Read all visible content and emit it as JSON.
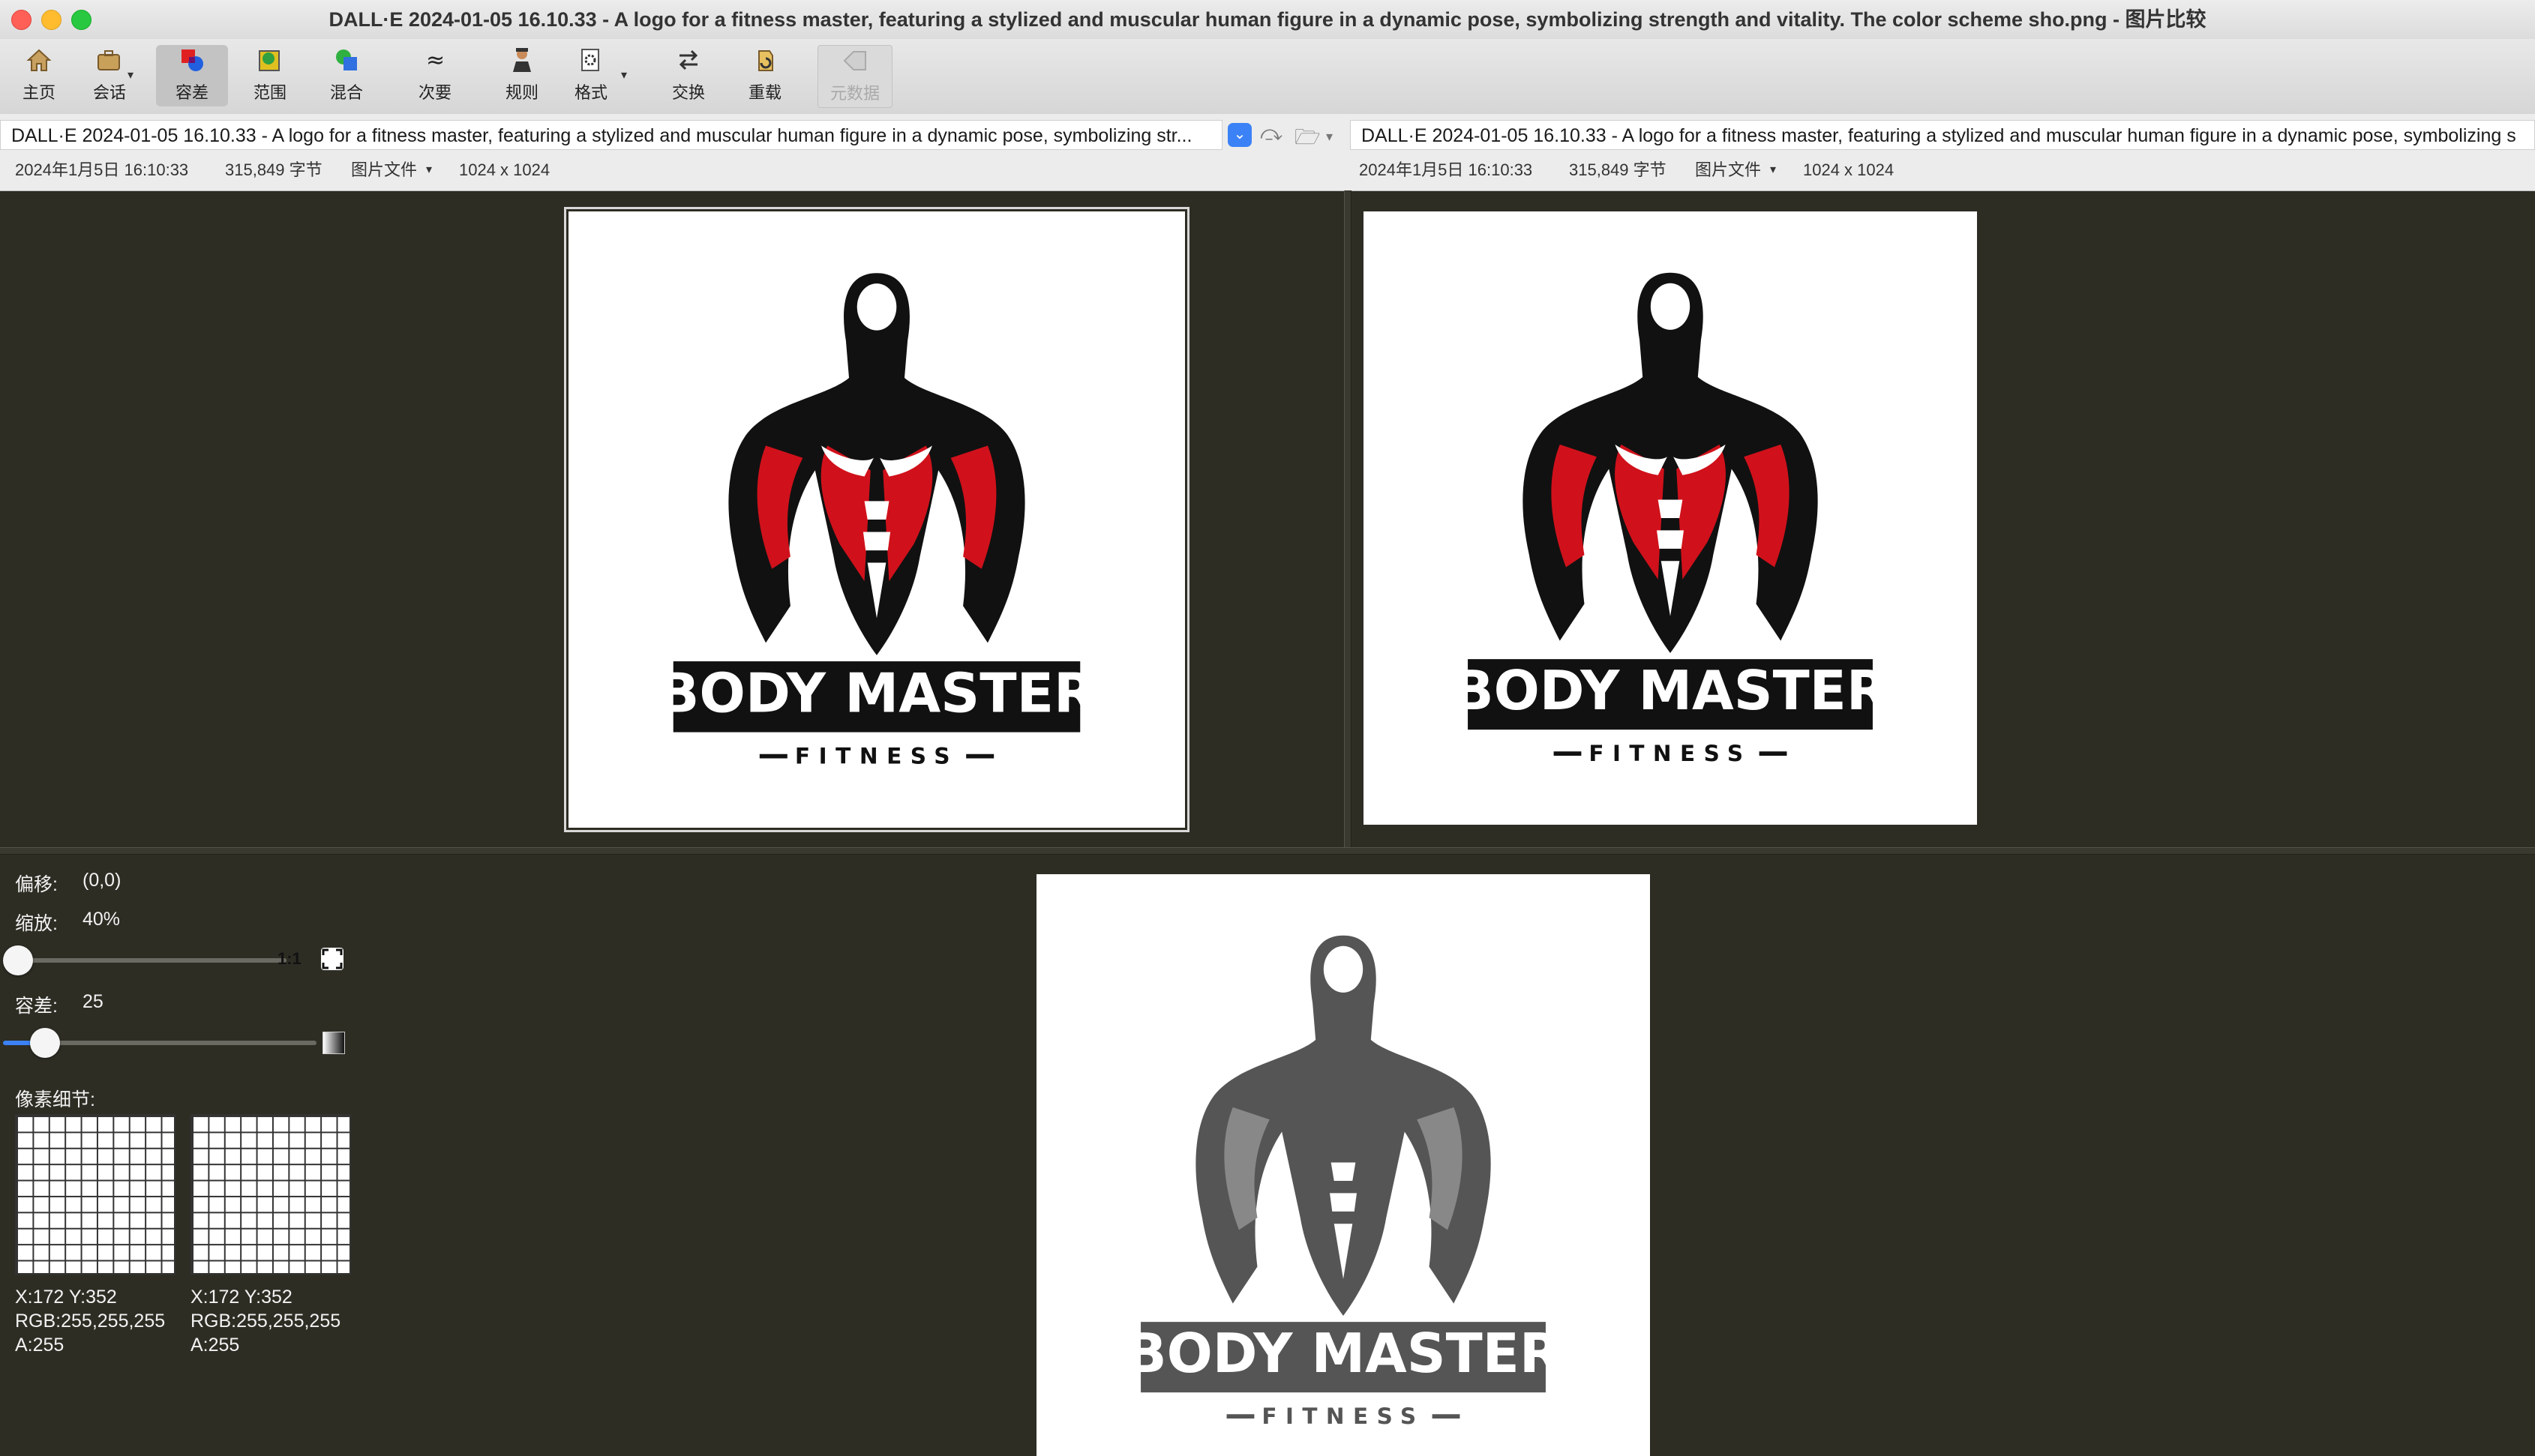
{
  "window": {
    "title": "DALL·E 2024-01-05 16.10.33 - A logo for a fitness master, featuring a stylized and muscular human figure in a dynamic pose, symbolizing strength and vitality. The color scheme sho.png - 图片比较"
  },
  "toolbar": {
    "items": [
      {
        "label": "主页",
        "icon": "home-icon"
      },
      {
        "label": "会话",
        "icon": "briefcase-icon"
      },
      {
        "label": "容差",
        "icon": "tolerance-icon"
      },
      {
        "label": "范围",
        "icon": "range-icon"
      },
      {
        "label": "混合",
        "icon": "blend-icon"
      },
      {
        "label": "次要",
        "icon": "approx-icon"
      },
      {
        "label": "规则",
        "icon": "rules-icon"
      },
      {
        "label": "格式",
        "icon": "format-icon"
      },
      {
        "label": "交换",
        "icon": "swap-icon"
      },
      {
        "label": "重载",
        "icon": "reload-icon"
      },
      {
        "label": "元数据",
        "icon": "metadata-icon"
      }
    ]
  },
  "left_file": {
    "path": "DALL·E 2024-01-05 16.10.33 - A logo for a fitness master, featuring a stylized and muscular human figure in a dynamic pose, symbolizing str...",
    "date": "2024年1月5日 16:10:33",
    "size": "315,849 字节",
    "type": "图片文件",
    "dimensions": "1024 x 1024"
  },
  "right_file": {
    "path": "DALL·E 2024-01-05 16.10.33 - A logo for a fitness master, featuring a stylized and muscular human figure in a dynamic pose, symbolizing s",
    "date": "2024年1月5日 16:10:33",
    "size": "315,849 字节",
    "type": "图片文件",
    "dimensions": "1024 x 1024"
  },
  "logo": {
    "line1": "BODY MASTER",
    "line2": "FITNESS",
    "accent_color": "#d0111b",
    "dark_color": "#111111",
    "diff_color": "#555555"
  },
  "controls": {
    "offset_label": "偏移:",
    "offset_value": "(0,0)",
    "zoom_label": "缩放:",
    "zoom_value": "40%",
    "one_to_one": "1:1",
    "tolerance_label": "容差:",
    "tolerance_value": "25",
    "pixel_detail_label": "像素细节:"
  },
  "pixel_left": {
    "coords": "X:172 Y:352",
    "rgb": "RGB:255,255,255",
    "alpha": "A:255"
  },
  "pixel_right": {
    "coords": "X:172 Y:352",
    "rgb": "RGB:255,255,255",
    "alpha": "A:255"
  }
}
